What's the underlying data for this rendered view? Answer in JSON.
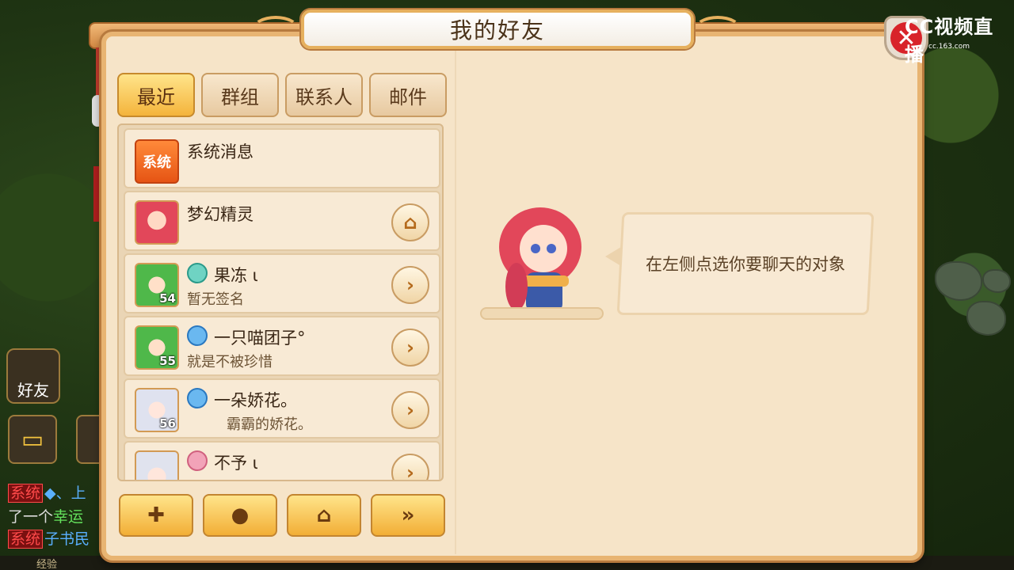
{
  "window": {
    "title": "我的好友"
  },
  "watermark": {
    "brand": "CC视频直播",
    "url": "cc.163.com"
  },
  "tabs": [
    {
      "label": "最近",
      "active": true
    },
    {
      "label": "群组",
      "active": false
    },
    {
      "label": "联系人",
      "active": false
    },
    {
      "label": "邮件",
      "active": false
    }
  ],
  "list": {
    "system": {
      "icon_text": "系统",
      "name": "系统消息"
    },
    "items": [
      {
        "name": "梦幻精灵",
        "signature": "",
        "level": "",
        "status_icon": "",
        "action_icon": "home-icon"
      },
      {
        "name": "果冻 ι",
        "signature": "暂无签名",
        "level": "54",
        "status_icon": "teal-status-icon",
        "action_icon": "chevron-right-icon"
      },
      {
        "name": "一只喵团子°",
        "signature": "就是不被珍惜",
        "level": "55",
        "status_icon": "blue-status-icon",
        "action_icon": "chevron-right-icon"
      },
      {
        "name": "一朵娇花。",
        "signature": "霸霸的娇花。",
        "level": "56",
        "status_icon": "blue-status-icon",
        "action_icon": "chevron-right-icon"
      },
      {
        "name": "不予 ι",
        "signature": "",
        "level": "",
        "status_icon": "lotus-status-icon",
        "action_icon": "chevron-right-icon"
      }
    ]
  },
  "bottom_buttons": [
    "add-friend-icon",
    "chat-bubble-icon",
    "home-icon",
    "double-chevron-icon"
  ],
  "bubble": {
    "text": "在左侧点选你要聊天的对象"
  },
  "hud": {
    "friend_label": "好友",
    "chat": [
      {
        "tag": "系统",
        "text": "◆、上"
      },
      {
        "tag": "",
        "text_prefix": "了一个",
        "text_highlight": "幸运"
      },
      {
        "tag": "系统",
        "text": "子书民"
      }
    ],
    "xp_label": "经验"
  },
  "colors": {
    "panel_bg": "#f6e4c8",
    "tab_active": "#f4b43c",
    "frame": "#e8b472",
    "close_red": "#d8232a"
  }
}
